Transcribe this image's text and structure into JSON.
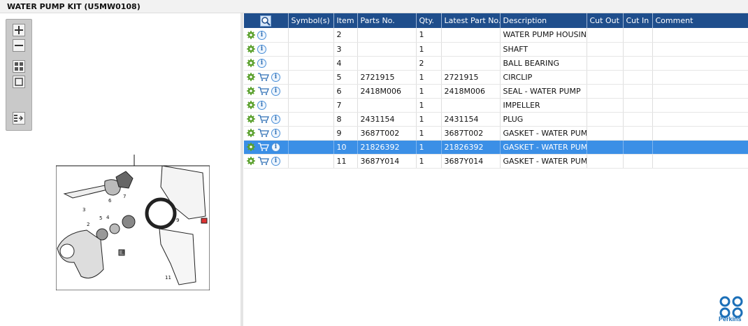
{
  "window": {
    "title": "WATER PUMP KIT (U5MW0108)"
  },
  "toolbar": {
    "buttons": [
      {
        "icon": "zoom-in-icon"
      },
      {
        "icon": "zoom-out-icon"
      },
      {
        "icon": "fit-page-icon"
      },
      {
        "icon": "actual-size-icon"
      },
      {
        "icon": "export-icon"
      }
    ]
  },
  "diagram": {
    "callouts": [
      "1",
      "2",
      "3",
      "4",
      "5",
      "6",
      "7",
      "8",
      "9",
      "10",
      "11"
    ]
  },
  "grid": {
    "header_icon": "magnifier-icon",
    "columns": [
      "Symbol(s)",
      "Item",
      "Parts No.",
      "Qty.",
      "Latest Part No.",
      "Description",
      "Cut Out",
      "Cut In",
      "Comment"
    ],
    "rows": [
      {
        "item": "2",
        "parts_no": "",
        "qty": "1",
        "latest": "",
        "description": "WATER PUMP HOUSING",
        "cart": false
      },
      {
        "item": "3",
        "parts_no": "",
        "qty": "1",
        "latest": "",
        "description": "SHAFT",
        "cart": false
      },
      {
        "item": "4",
        "parts_no": "",
        "qty": "2",
        "latest": "",
        "description": "BALL BEARING",
        "cart": false
      },
      {
        "item": "5",
        "parts_no": "2721915",
        "qty": "1",
        "latest": "2721915",
        "description": "CIRCLIP",
        "cart": true
      },
      {
        "item": "6",
        "parts_no": "2418M006",
        "qty": "1",
        "latest": "2418M006",
        "description": "SEAL - WATER PUMP",
        "cart": true
      },
      {
        "item": "7",
        "parts_no": "",
        "qty": "1",
        "latest": "",
        "description": "IMPELLER",
        "cart": false
      },
      {
        "item": "8",
        "parts_no": "2431154",
        "qty": "1",
        "latest": "2431154",
        "description": "PLUG",
        "cart": true
      },
      {
        "item": "9",
        "parts_no": "3687T002",
        "qty": "1",
        "latest": "3687T002",
        "description": "GASKET - WATER PUMP",
        "cart": true
      },
      {
        "item": "10",
        "parts_no": "21826392",
        "qty": "1",
        "latest": "21826392",
        "description": "GASKET - WATER PUMP",
        "cart": true,
        "selected": true
      },
      {
        "item": "11",
        "parts_no": "3687Y014",
        "qty": "1",
        "latest": "3687Y014",
        "description": "GASKET - WATER PUMP",
        "cart": true
      }
    ]
  },
  "brand": {
    "name": "Perkins",
    "color": "#1b6fb8"
  },
  "colors": {
    "header": "#1f4e8c",
    "selected": "#3b8fe6",
    "gear": "#5aa02c"
  }
}
